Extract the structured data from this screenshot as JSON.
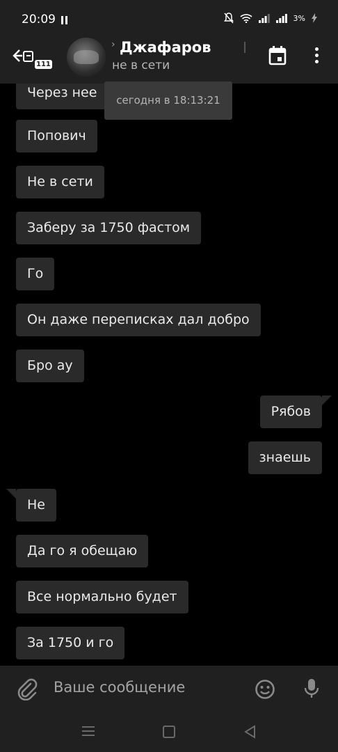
{
  "status_bar": {
    "time": "20:09",
    "battery": "3%"
  },
  "header": {
    "back_badge": "111",
    "contact_name": "Джафаров",
    "contact_status": "не в сети"
  },
  "tooltip": "сегодня в 18:13:21",
  "messages": [
    {
      "text": "Через нее",
      "dir": "in"
    },
    {
      "text": "Попович",
      "dir": "in"
    },
    {
      "text": "Не в сети",
      "dir": "in"
    },
    {
      "text": "Заберу за 1750 фастом",
      "dir": "in"
    },
    {
      "text": "Го",
      "dir": "in"
    },
    {
      "text": "Он даже переписках дал добро",
      "dir": "in"
    },
    {
      "text": "Бро ау",
      "dir": "in"
    },
    {
      "text": "Рябов",
      "dir": "out"
    },
    {
      "text": "знаешь",
      "dir": "out"
    },
    {
      "text": "Не",
      "dir": "in"
    },
    {
      "text": "Да го я обещаю",
      "dir": "in"
    },
    {
      "text": "Все нормально будет",
      "dir": "in"
    },
    {
      "text": "За 1750 и го",
      "dir": "in"
    }
  ],
  "composer": {
    "placeholder": "Ваше сообщение"
  },
  "colors": {
    "bubble": "#2a2a2a",
    "bar": "#202020",
    "background": "#000000"
  }
}
